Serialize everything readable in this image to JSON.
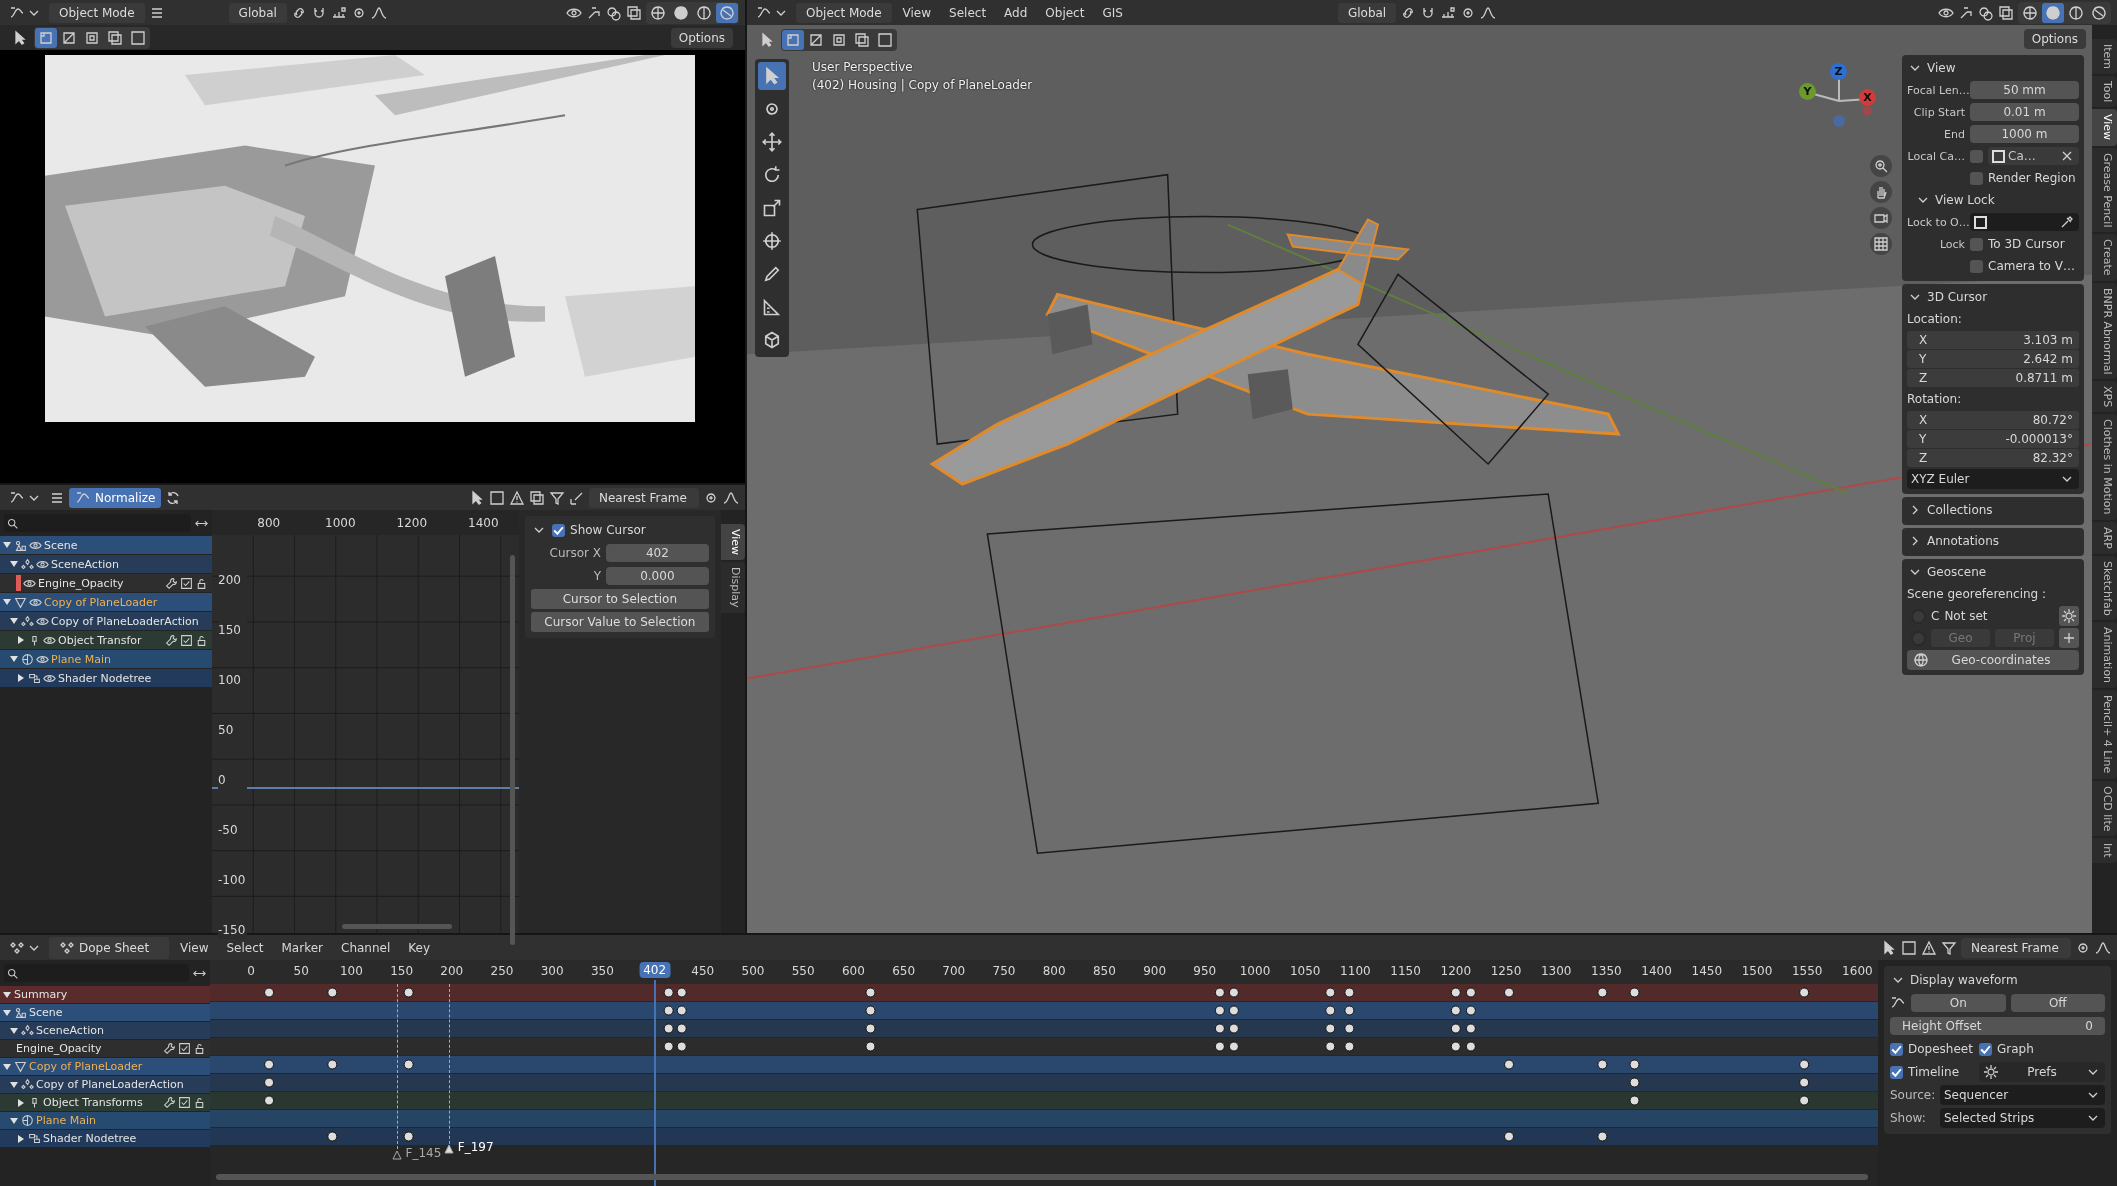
{
  "image_editor": {
    "header": {
      "mode": "Object Mode",
      "orientation": "Global"
    },
    "select_modes": [
      {
        "selected": true
      },
      {
        "selected": false
      },
      {
        "selected": false
      },
      {
        "selected": false
      },
      {
        "selected": false
      }
    ],
    "shading_modes": [
      {
        "selected": false
      },
      {
        "selected": false
      },
      {
        "selected": false
      },
      {
        "selected": true
      }
    ],
    "options": "Options"
  },
  "graph_editor": {
    "normalize": {
      "label": "Normalize",
      "on": true
    },
    "snap": "Nearest Frame",
    "channels": [
      {
        "name": "Scene",
        "kind": "scene",
        "expanded": true,
        "selected": false,
        "children": [
          {
            "name": "SceneAction",
            "kind": "action",
            "expanded": true,
            "selected": false,
            "children": [
              {
                "name": "Engine_Opacity",
                "kind": "fcurve",
                "color": "#e05a5a",
                "selected": false
              }
            ]
          }
        ]
      },
      {
        "name": "Copy of PlaneLoader",
        "kind": "object",
        "expanded": true,
        "selected": true,
        "children": [
          {
            "name": "Copy of PlaneLoaderAction",
            "kind": "action",
            "expanded": true,
            "selected": false,
            "children": [
              {
                "name": "Object Transfor",
                "kind": "group",
                "expanded": false,
                "selected": false
              }
            ]
          },
          {
            "name": "Plane Main",
            "kind": "material",
            "expanded": true,
            "selected": true,
            "children": [
              {
                "name": "Shader Nodetree",
                "kind": "nodetree",
                "expanded": false,
                "selected": false
              }
            ]
          }
        ]
      }
    ],
    "x_ruler": [
      "800",
      "1000",
      "1200",
      "1400"
    ],
    "y_ruler": [
      "200",
      "150",
      "100",
      "50",
      "0",
      "-50",
      "-100",
      "-150"
    ],
    "sidebar": {
      "show_cursor": {
        "label": "Show Cursor",
        "checked": true
      },
      "cursor_x": {
        "label": "Cursor X",
        "value": "402"
      },
      "cursor_y": {
        "label": "Y",
        "value": "0.000"
      },
      "buttons": [
        "Cursor to Selection",
        "Cursor Value to Selection"
      ],
      "tabs": [
        {
          "label": "View",
          "selected": true
        },
        {
          "label": "Display",
          "selected": false
        }
      ]
    }
  },
  "viewport": {
    "header": {
      "mode": "Object Mode",
      "menus": [
        "View",
        "Select",
        "Add",
        "Object",
        "GIS"
      ],
      "orientation": "Global"
    },
    "select_modes": [
      {
        "selected": true
      },
      {
        "selected": false
      },
      {
        "selected": false
      },
      {
        "selected": false
      },
      {
        "selected": false
      }
    ],
    "shading_modes": [
      {
        "selected": false
      },
      {
        "selected": true
      },
      {
        "selected": false
      },
      {
        "selected": false
      }
    ],
    "options": "Options",
    "tools": [
      {
        "kind": "select",
        "selected": true
      },
      {
        "kind": "cursor",
        "selected": false
      },
      {
        "kind": "move",
        "selected": false
      },
      {
        "kind": "rotate",
        "selected": false
      },
      {
        "kind": "scale",
        "selected": false
      },
      {
        "kind": "transform",
        "selected": false
      },
      {
        "kind": "annotate",
        "selected": false
      },
      {
        "kind": "measure",
        "selected": false
      },
      {
        "kind": "add_cube",
        "selected": false
      }
    ],
    "info": [
      "User Perspective",
      "(402) Housing | Copy of PlaneLoader"
    ],
    "gizmo_axes": [
      {
        "label": "Z",
        "color": "#2f6fd0"
      },
      {
        "label": "Y",
        "color": "#6a9a2a"
      },
      {
        "label": "X",
        "color": "#d03b3b"
      }
    ],
    "sidebar": [
      {
        "title": "View",
        "expanded": true,
        "rows": [
          {
            "kind": "field",
            "label": "Focal Len…",
            "value": "50 mm"
          },
          {
            "kind": "field",
            "label": "Clip Start",
            "value": "0.01 m"
          },
          {
            "kind": "field",
            "label": "End",
            "value": "1000 m"
          },
          {
            "kind": "object_field",
            "label": "Local Ca…",
            "checked": false,
            "value": "Ca…"
          },
          {
            "kind": "check",
            "label": "Render Region",
            "checked": false
          },
          {
            "kind": "subpanel",
            "label": "View Lock",
            "expanded": true
          },
          {
            "kind": "lock_object",
            "label": "Lock to O…"
          },
          {
            "kind": "check",
            "prefix": "Lock",
            "label": "To 3D Cursor",
            "checked": false
          },
          {
            "kind": "check",
            "label": "Camera to V…",
            "checked": false
          }
        ]
      },
      {
        "title": "3D Cursor",
        "expanded": true,
        "rows": [
          {
            "kind": "caption",
            "label": "Location:"
          },
          {
            "kind": "vector",
            "items": [
              {
                "axis": "X",
                "value": "3.103 m"
              },
              {
                "axis": "Y",
                "value": "2.642 m"
              },
              {
                "axis": "Z",
                "value": "0.8711 m"
              }
            ]
          },
          {
            "kind": "caption",
            "label": "Rotation:"
          },
          {
            "kind": "vector",
            "items": [
              {
                "axis": "X",
                "value": "80.72°"
              },
              {
                "axis": "Y",
                "value": "-0.000013°"
              },
              {
                "axis": "Z",
                "value": "82.32°"
              }
            ]
          },
          {
            "kind": "dropdown",
            "value": "XYZ Euler"
          }
        ]
      },
      {
        "title": "Collections",
        "expanded": false
      },
      {
        "title": "Annotations",
        "expanded": false
      },
      {
        "title": "Geoscene",
        "expanded": true,
        "rows": [
          {
            "kind": "caption",
            "label": "Scene georeferencing :"
          },
          {
            "kind": "geo_status",
            "selected": false,
            "letter": "C",
            "value": "Not set"
          },
          {
            "kind": "geo_buttons",
            "selected": false,
            "buttons": [
              "Geo",
              "Proj"
            ]
          },
          {
            "kind": "button",
            "label": "Geo-coordinates"
          }
        ]
      }
    ],
    "tabs": [
      {
        "label": "Item",
        "selected": false
      },
      {
        "label": "Tool",
        "selected": false
      },
      {
        "label": "View",
        "selected": true
      },
      {
        "label": "Grease Pencil",
        "selected": false
      },
      {
        "label": "Create",
        "selected": false
      },
      {
        "label": "BNPR Abnormal",
        "selected": false
      },
      {
        "label": "XPS",
        "selected": false
      },
      {
        "label": "Clothes in Motion",
        "selected": false
      },
      {
        "label": "ARP",
        "selected": false
      },
      {
        "label": "Sketchfab",
        "selected": false
      },
      {
        "label": "Animation",
        "selected": false
      },
      {
        "label": "Pencil+ 4 Line",
        "selected": false
      },
      {
        "label": "OCD lite",
        "selected": false
      },
      {
        "label": "Int",
        "selected": false
      }
    ]
  },
  "dope_sheet": {
    "header": {
      "editor": "Dope Sheet",
      "menus": [
        "View",
        "Select",
        "Marker",
        "Channel",
        "Key"
      ],
      "snap": "Nearest Frame"
    },
    "summary": {
      "label": "Summary",
      "expanded": true
    },
    "channels": [
      {
        "name": "Scene",
        "kind": "scene",
        "expanded": true,
        "selected": false,
        "children": [
          {
            "name": "SceneAction",
            "kind": "action",
            "expanded": true,
            "selected": false,
            "children": [
              {
                "name": "Engine_Opacity",
                "kind": "fcurve",
                "selected": false
              }
            ]
          }
        ]
      },
      {
        "name": "Copy of PlaneLoader",
        "kind": "object",
        "expanded": true,
        "selected": true,
        "children": [
          {
            "name": "Copy of PlaneLoaderAction",
            "kind": "action",
            "expanded": true,
            "selected": false,
            "children": [
              {
                "name": "Object Transforms",
                "kind": "group",
                "expanded": false,
                "selected": false
              }
            ]
          },
          {
            "name": "Plane Main",
            "kind": "material",
            "expanded": true,
            "selected": true,
            "children": [
              {
                "name": "Shader Nodetree",
                "kind": "nodetree",
                "expanded": false,
                "selected": false
              }
            ]
          }
        ]
      }
    ],
    "current_frame": "402",
    "ruler": [
      "0",
      "50",
      "100",
      "150",
      "200",
      "250",
      "300",
      "350",
      "450",
      "500",
      "550",
      "600",
      "650",
      "700",
      "750",
      "800",
      "850",
      "900",
      "950",
      "1000",
      "1050",
      "1100",
      "1150",
      "1200",
      "1250",
      "1300",
      "1350",
      "1400",
      "1450",
      "1500",
      "1550",
      "1600"
    ],
    "markers": [
      {
        "label": "F_145",
        "selected": false
      },
      {
        "label": "F_197",
        "selected": true
      }
    ],
    "sidebar": {
      "title": "Display waveform",
      "expanded": true,
      "toggle": [
        {
          "label": "On"
        },
        {
          "label": "Off"
        }
      ],
      "height_offset": {
        "label": "Height Offset",
        "value": "0"
      },
      "checks": [
        {
          "label": "Dopesheet",
          "checked": true
        },
        {
          "label": "Graph",
          "checked": true
        },
        {
          "label": "Timeline",
          "checked": true
        }
      ],
      "prefs": "Prefs",
      "source": {
        "label": "Source:",
        "value": "Sequencer"
      },
      "show": {
        "label": "Show:",
        "value": "Selected Strips"
      }
    }
  }
}
